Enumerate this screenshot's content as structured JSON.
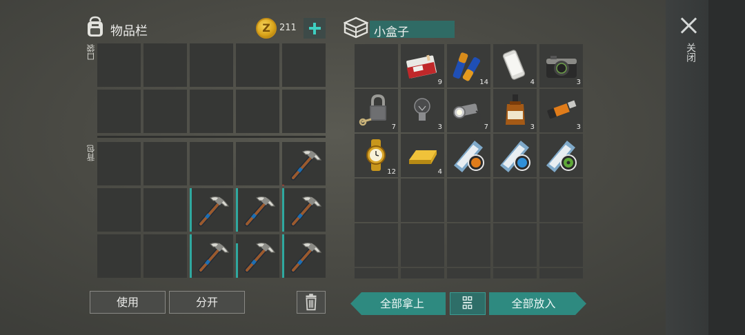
{
  "inventory": {
    "title": "物品栏",
    "coins": "211",
    "pocket_label": "口袋",
    "backpack_label": "背包"
  },
  "container": {
    "name": "小盒子"
  },
  "close_label": "关闭",
  "actions": {
    "use": "使用",
    "split": "分开",
    "take_all": "全部拿上",
    "put_all": "全部放入"
  },
  "pocket_slots": [
    {
      "item": ""
    },
    {
      "item": ""
    },
    {
      "item": ""
    },
    {
      "item": ""
    },
    {
      "item": ""
    },
    {
      "item": ""
    },
    {
      "item": ""
    },
    {
      "item": ""
    },
    {
      "item": ""
    },
    {
      "item": ""
    }
  ],
  "backpack_slots": [
    {
      "item": ""
    },
    {
      "item": ""
    },
    {
      "item": ""
    },
    {
      "item": ""
    },
    {
      "item": "pickaxe",
      "durability": 0.02
    },
    {
      "item": ""
    },
    {
      "item": ""
    },
    {
      "item": "pickaxe",
      "durability": 1.0
    },
    {
      "item": "pickaxe",
      "durability": 1.0
    },
    {
      "item": "pickaxe",
      "durability": 1.0
    },
    {
      "item": ""
    },
    {
      "item": ""
    },
    {
      "item": "pickaxe",
      "durability": 1.0
    },
    {
      "item": "pickaxe",
      "durability": 0.8
    },
    {
      "item": "pickaxe",
      "durability": 1.0
    }
  ],
  "box_slots": [
    {
      "item": "",
      "qty": ""
    },
    {
      "item": "cigarettes",
      "qty": "9"
    },
    {
      "item": "batteries",
      "qty": "14"
    },
    {
      "item": "smartphone",
      "qty": "4"
    },
    {
      "item": "camera",
      "qty": "3"
    },
    {
      "item": "padlock-key",
      "qty": "7"
    },
    {
      "item": "light-bulb",
      "qty": "3"
    },
    {
      "item": "flashlight",
      "qty": "7"
    },
    {
      "item": "whiskey",
      "qty": "3"
    },
    {
      "item": "usb-drive",
      "qty": "3"
    },
    {
      "item": "gold-watch",
      "qty": "12"
    },
    {
      "item": "gold-bar",
      "qty": "4"
    },
    {
      "item": "map-poster-orange",
      "qty": ""
    },
    {
      "item": "map-poster-blue",
      "qty": ""
    },
    {
      "item": "map-poster-green",
      "qty": ""
    }
  ],
  "colors": {
    "accent_teal": "#2e8a80",
    "durability_bar": "#2fa9a0",
    "coin_gold": "#d9a319"
  }
}
